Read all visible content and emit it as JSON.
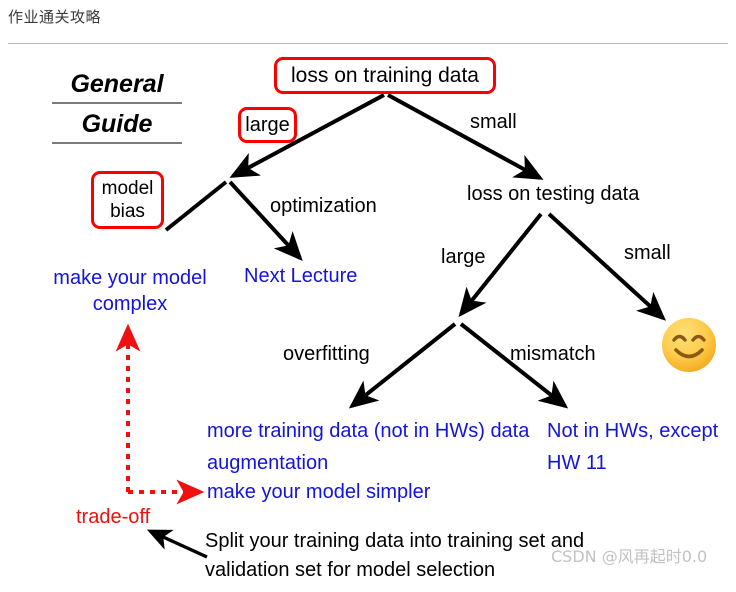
{
  "header": {
    "title": "作业通关攻略"
  },
  "slide": {
    "guide_title_line1": "General",
    "guide_title_line2": "Guide",
    "watermark": "CSDN @风再起时0.0"
  },
  "boxes": {
    "root": "loss on training data",
    "large": "large",
    "model_bias_line1": "model",
    "model_bias_line2": "bias"
  },
  "edge_labels": {
    "small_training": "small",
    "optimization": "optimization",
    "loss_testing": "loss on testing data",
    "large_testing": "large",
    "small_testing": "small",
    "overfitting": "overfitting",
    "mismatch": "mismatch"
  },
  "leaves": {
    "make_model_complex": "make your model complex",
    "next_lecture": "Next Lecture",
    "more_training_data": "more training data (not in HWs) data augmentation",
    "make_model_simpler": "make your model simpler",
    "not_in_hws": "Not in HWs, except HW 11",
    "trade_off": "trade-off",
    "split_note": "Split your training data into training set and validation set for model selection"
  },
  "colors": {
    "box_border": "#fb0000",
    "blue_text": "#1313e0",
    "red_text": "#f01010",
    "arrow_black": "#000000",
    "emoji_yellow": "#ffcc4d"
  },
  "icons": {
    "smiley": "smiley-face-icon"
  }
}
